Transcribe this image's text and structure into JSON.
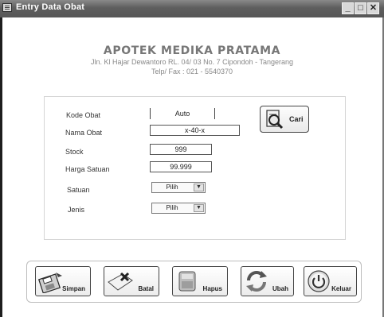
{
  "window": {
    "title": "Entry Data Obat"
  },
  "header": {
    "name": "APOTEK MEDIKA PRATAMA",
    "address": "Jln. Kl Hajar Dewantoro RL. 04/ 03 No. 7 Cipondoh - Tangerang",
    "contact": "Telp/ Fax : 021 - 5540370"
  },
  "form": {
    "kode": {
      "label": "Kode Obat",
      "value": "Auto"
    },
    "nama": {
      "label": "Nama Obat",
      "value": "x-40-x"
    },
    "stock": {
      "label": "Stock",
      "value": "999"
    },
    "harga": {
      "label": "Harga Satuan",
      "value": "99.999"
    },
    "satuan": {
      "label": "Satuan",
      "value": "Pilih"
    },
    "jenis": {
      "label": "Jenis",
      "value": "Pilih"
    },
    "cari_label": "Cari"
  },
  "actions": {
    "simpan": "Simpan",
    "batal": "Batal",
    "hapus": "Hapus",
    "ubah": "Ubah",
    "keluar": "Keluar"
  },
  "icons": {
    "app": "window-icon",
    "cari": "search-document-icon",
    "simpan": "floppy-save-icon",
    "batal": "cancel-icon",
    "hapus": "delete-icon",
    "ubah": "refresh-icon",
    "keluar": "power-icon"
  }
}
